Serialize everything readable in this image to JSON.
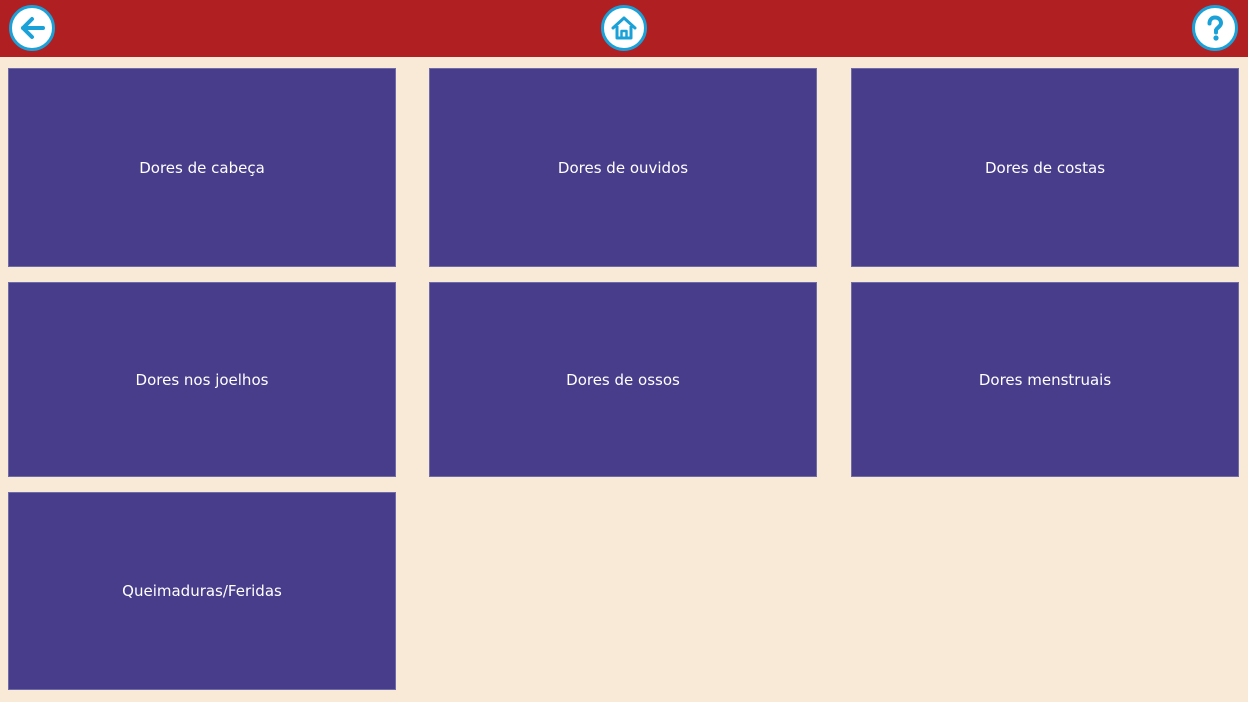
{
  "toolbar": {
    "back_icon": "arrow-left-icon",
    "home_icon": "home-icon",
    "help_icon": "question-mark-icon"
  },
  "colors": {
    "header": "#b01f22",
    "background": "#f8ead7",
    "tile": "#483d8b",
    "icon_accent": "#1aa2d8"
  },
  "tiles": [
    {
      "label": "Dores de cabeça"
    },
    {
      "label": "Dores de ouvidos"
    },
    {
      "label": "Dores de costas"
    },
    {
      "label": "Dores nos joelhos"
    },
    {
      "label": "Dores de ossos"
    },
    {
      "label": "Dores menstruais"
    },
    {
      "label": "Queimaduras/Feridas"
    }
  ]
}
